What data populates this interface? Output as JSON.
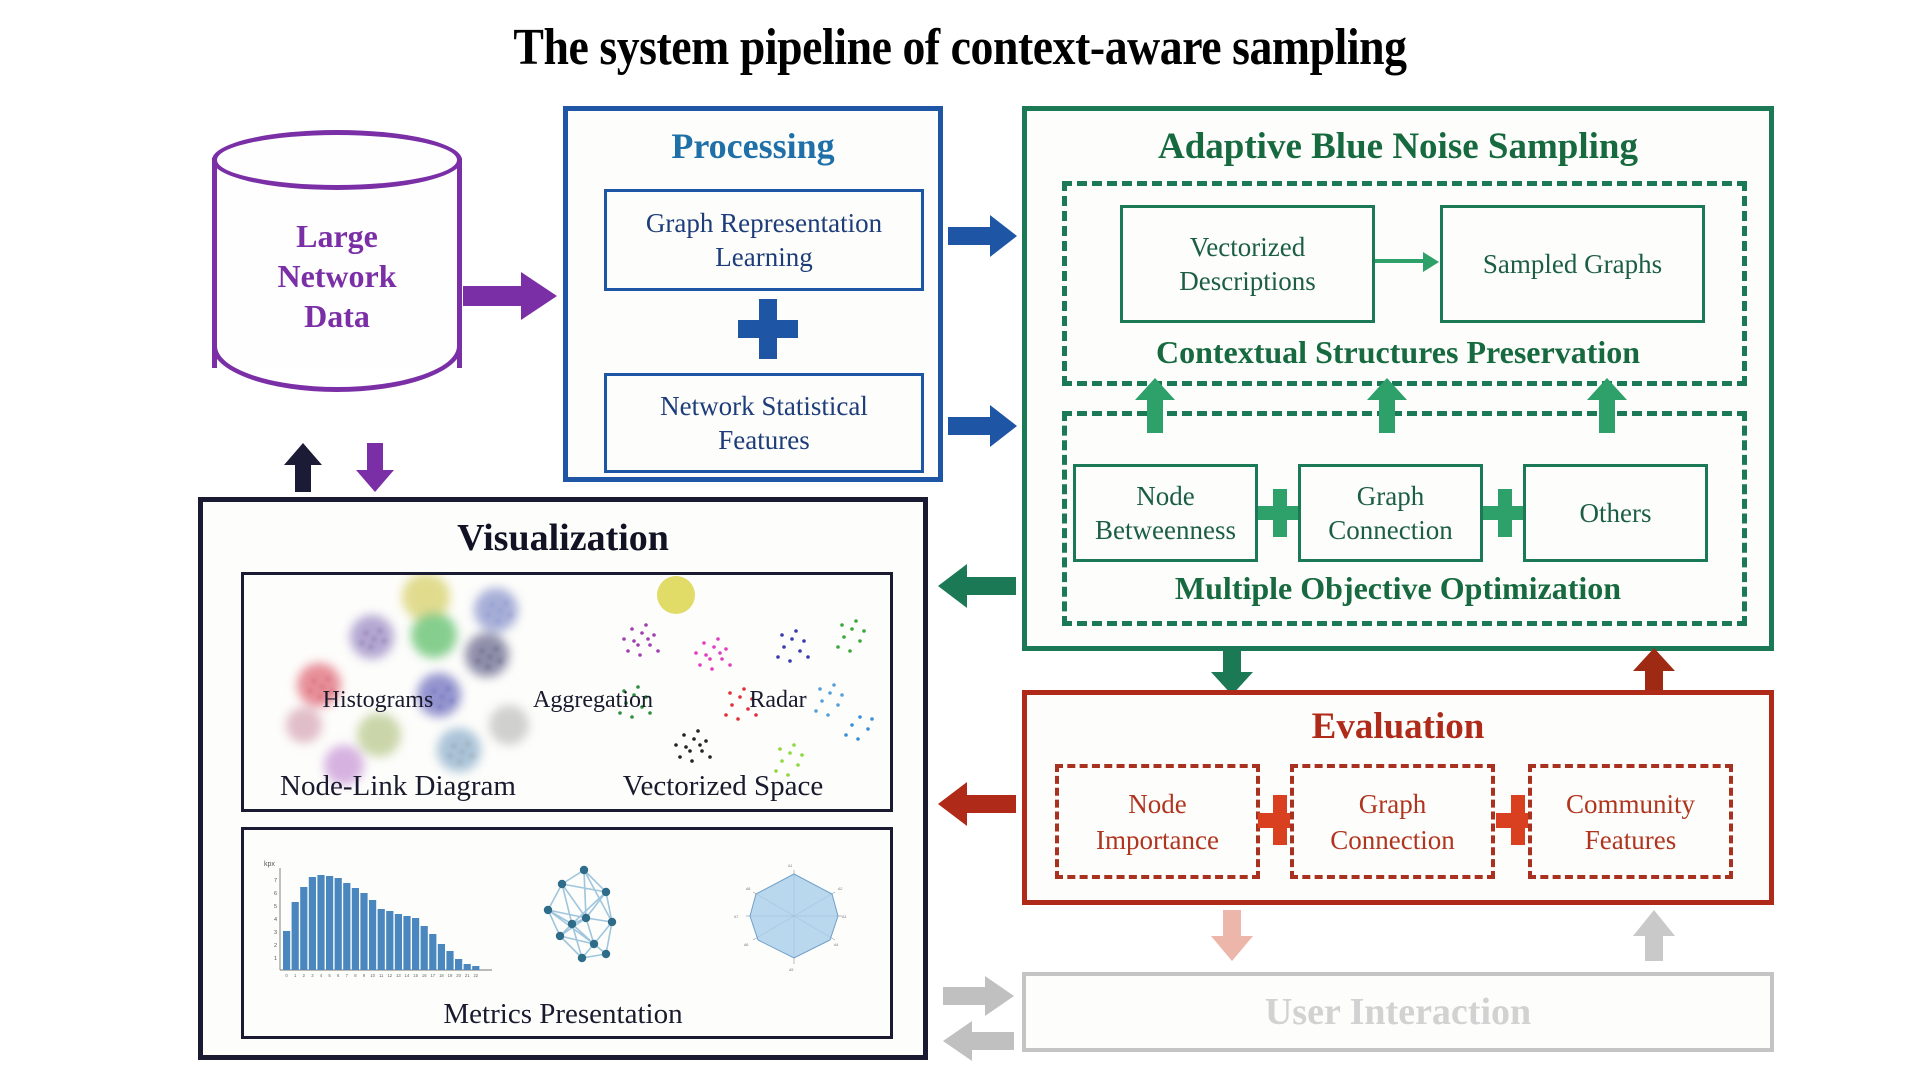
{
  "title": "The system pipeline of context-aware sampling",
  "colors": {
    "purple": "#7B2FA6",
    "blue": "#1F55A5",
    "blue_title": "#1F6FA8",
    "green_dark": "#176A3F",
    "green": "#1B7A55",
    "green_bright": "#2EA06A",
    "red": "#B02A1A",
    "gray": "#C4C4C4",
    "navy": "#1A1A33"
  },
  "database": {
    "label_lines": [
      "Large",
      "Network",
      "Data"
    ],
    "label": "Large Network Data"
  },
  "processing": {
    "title": "Processing",
    "items": [
      {
        "label": "Graph Representation Learning",
        "lines": [
          "Graph Representation",
          "Learning"
        ]
      },
      {
        "label": "Network Statistical Features",
        "lines": [
          "Network Statistical",
          "Features"
        ]
      }
    ],
    "operator": "+"
  },
  "sampling": {
    "title": "Adaptive Blue Noise Sampling",
    "contextual": {
      "caption": "Contextual Structures Preservation",
      "boxes": [
        {
          "label": "Vectorized Descriptions",
          "lines": [
            "Vectorized",
            "Descriptions"
          ]
        },
        {
          "label": "Sampled Graphs",
          "lines": [
            "Sampled Graphs"
          ]
        }
      ]
    },
    "optimization": {
      "caption": "Multiple Objective Optimization",
      "boxes": [
        {
          "label": "Node Betweenness",
          "lines": [
            "Node",
            "Betweenness"
          ]
        },
        {
          "label": "Graph Connection",
          "lines": [
            "Graph",
            "Connection"
          ]
        },
        {
          "label": "Others",
          "lines": [
            "Others"
          ]
        }
      ],
      "operator": "+"
    }
  },
  "evaluation": {
    "title": "Evaluation",
    "boxes": [
      {
        "label": "Node Importance",
        "lines": [
          "Node",
          "Importance"
        ]
      },
      {
        "label": "Graph Connection",
        "lines": [
          "Graph",
          "Connection"
        ]
      },
      {
        "label": "Community Features",
        "lines": [
          "Community",
          "Features"
        ]
      }
    ],
    "operator": "+"
  },
  "user_interaction": {
    "title": "User Interaction"
  },
  "visualization": {
    "title": "Visualization",
    "top_panel": {
      "labels": [
        "Node-Link Diagram",
        "Vectorized Space"
      ]
    },
    "bottom_panel": {
      "sub_labels": [
        "Histograms",
        "Aggregation",
        "Radar"
      ],
      "caption": "Metrics Presentation"
    },
    "histogram_axis_label": "kpx"
  },
  "chart_data": {
    "type": "bar",
    "title": "Histograms",
    "xlabel": "",
    "ylabel": "kpx",
    "categories": [
      "0",
      "1",
      "2",
      "3",
      "4",
      "5",
      "6",
      "7",
      "8",
      "9",
      "10",
      "11",
      "12",
      "13",
      "14",
      "15",
      "16",
      "17",
      "18",
      "19",
      "20",
      "21",
      "22"
    ],
    "values": [
      3.0,
      5.2,
      6.4,
      7.2,
      7.35,
      7.3,
      7.1,
      6.8,
      6.4,
      6.0,
      5.5,
      4.8,
      4.6,
      4.4,
      4.2,
      4.1,
      3.5,
      2.8,
      2.0,
      1.5,
      0.9,
      0.5,
      0.35
    ],
    "ylim": [
      0,
      8
    ],
    "yticks": [
      "1",
      "2",
      "3",
      "4",
      "5",
      "6",
      "7"
    ],
    "grid": false,
    "legend": "none",
    "series_color": "#3E7CB1"
  },
  "icons": {
    "plus": "+",
    "arrow_right": "arrow-right-icon",
    "arrow_left": "arrow-left-icon",
    "arrow_up": "arrow-up-icon",
    "arrow_down": "arrow-down-icon"
  }
}
